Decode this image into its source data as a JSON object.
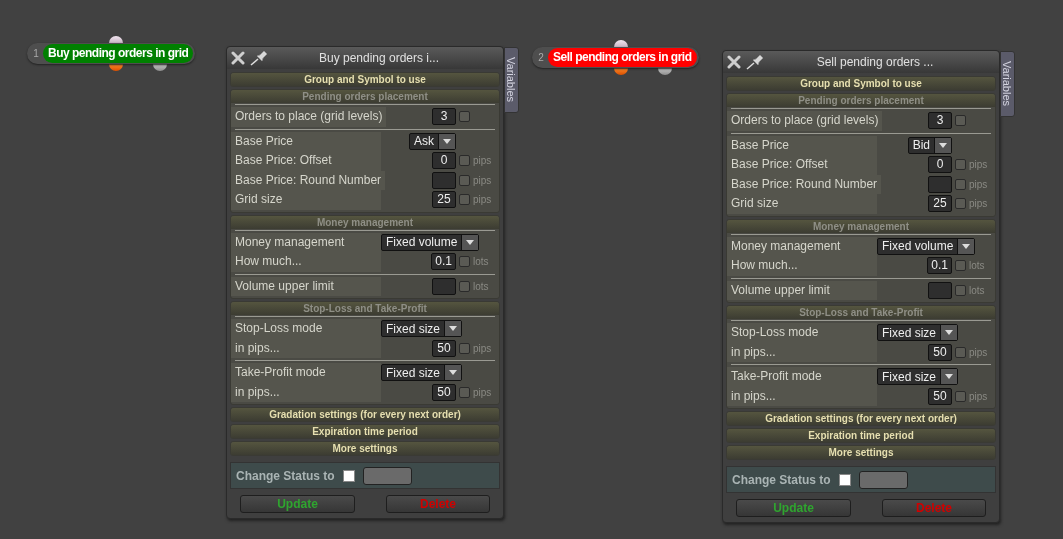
{
  "nodes": [
    {
      "number": "1",
      "label": "Buy pending orders in grid",
      "color": "#008000"
    },
    {
      "number": "2",
      "label": "Sell pending orders in grid",
      "color": "#ff0000"
    }
  ],
  "panels": [
    {
      "title": "Buy pending orders i...",
      "side_tab": "Variables",
      "sections": [
        {
          "title": "Group and Symbol to use",
          "expanded": false
        },
        {
          "title": "Pending orders placement",
          "expanded": true,
          "groups": [
            [
              {
                "kind": "number",
                "label": "Orders to place (grid levels)",
                "value": "3",
                "checked": false
              }
            ],
            [
              {
                "kind": "select",
                "label": "Base Price",
                "value": "Ask"
              },
              {
                "kind": "number",
                "label": "Base Price: Offset",
                "value": "0",
                "unit": "pips",
                "checked": false
              },
              {
                "kind": "number",
                "label": "Base Price: Round Number",
                "unit": "pips",
                "checked": false
              },
              {
                "kind": "number",
                "label": "Grid size",
                "value": "25",
                "unit": "pips",
                "checked": false
              }
            ]
          ]
        },
        {
          "title": "Money management",
          "expanded": true,
          "groups": [
            [
              {
                "kind": "select",
                "label": "Money management",
                "value": "Fixed volume"
              },
              {
                "kind": "number",
                "label": "How much...",
                "value": "0.1",
                "unit": "lots",
                "checked": false
              }
            ],
            [
              {
                "kind": "number",
                "label": "Volume upper limit",
                "unit": "lots",
                "checked": false
              }
            ]
          ]
        },
        {
          "title": "Stop-Loss and Take-Profit",
          "expanded": true,
          "groups": [
            [
              {
                "kind": "select",
                "label": "Stop-Loss mode",
                "value": "Fixed size"
              },
              {
                "kind": "number",
                "label": "in pips...",
                "value": "50",
                "unit": "pips",
                "checked": false
              }
            ],
            [
              {
                "kind": "select",
                "label": "Take-Profit mode",
                "value": "Fixed size"
              },
              {
                "kind": "number",
                "label": "in pips...",
                "value": "50",
                "unit": "pips",
                "checked": false
              }
            ]
          ]
        },
        {
          "title": "Gradation settings (for every next order)",
          "expanded": false
        },
        {
          "title": "Expiration time period",
          "expanded": false
        },
        {
          "title": "More settings",
          "expanded": false
        }
      ],
      "status": {
        "label": "Change Status to",
        "checked": false
      },
      "buttons": [
        {
          "label": "Update",
          "color": "#2fa52f"
        },
        {
          "label": "Delete",
          "color": "#d00000"
        }
      ]
    },
    {
      "title": "Sell pending orders ...",
      "side_tab": "Variables",
      "sections": [
        {
          "title": "Group and Symbol to use",
          "expanded": false
        },
        {
          "title": "Pending orders placement",
          "expanded": true,
          "groups": [
            [
              {
                "kind": "number",
                "label": "Orders to place (grid levels)",
                "value": "3",
                "checked": false
              }
            ],
            [
              {
                "kind": "select",
                "label": "Base Price",
                "value": "Bid"
              },
              {
                "kind": "number",
                "label": "Base Price: Offset",
                "value": "0",
                "unit": "pips",
                "checked": false
              },
              {
                "kind": "number",
                "label": "Base Price: Round Number",
                "unit": "pips",
                "checked": false
              },
              {
                "kind": "number",
                "label": "Grid size",
                "value": "25",
                "unit": "pips",
                "checked": false
              }
            ]
          ]
        },
        {
          "title": "Money management",
          "expanded": true,
          "groups": [
            [
              {
                "kind": "select",
                "label": "Money management",
                "value": "Fixed volume"
              },
              {
                "kind": "number",
                "label": "How much...",
                "value": "0.1",
                "unit": "lots",
                "checked": false
              }
            ],
            [
              {
                "kind": "number",
                "label": "Volume upper limit",
                "unit": "lots",
                "checked": false
              }
            ]
          ]
        },
        {
          "title": "Stop-Loss and Take-Profit",
          "expanded": true,
          "groups": [
            [
              {
                "kind": "select",
                "label": "Stop-Loss mode",
                "value": "Fixed size"
              },
              {
                "kind": "number",
                "label": "in pips...",
                "value": "50",
                "unit": "pips",
                "checked": false
              }
            ],
            [
              {
                "kind": "select",
                "label": "Take-Profit mode",
                "value": "Fixed size"
              },
              {
                "kind": "number",
                "label": "in pips...",
                "value": "50",
                "unit": "pips",
                "checked": false
              }
            ]
          ]
        },
        {
          "title": "Gradation settings (for every next order)",
          "expanded": false
        },
        {
          "title": "Expiration time period",
          "expanded": false
        },
        {
          "title": "More settings",
          "expanded": false
        }
      ],
      "status": {
        "label": "Change Status to",
        "checked": false
      },
      "buttons": [
        {
          "label": "Update",
          "color": "#2fa52f"
        },
        {
          "label": "Delete",
          "color": "#d00000"
        }
      ]
    }
  ]
}
